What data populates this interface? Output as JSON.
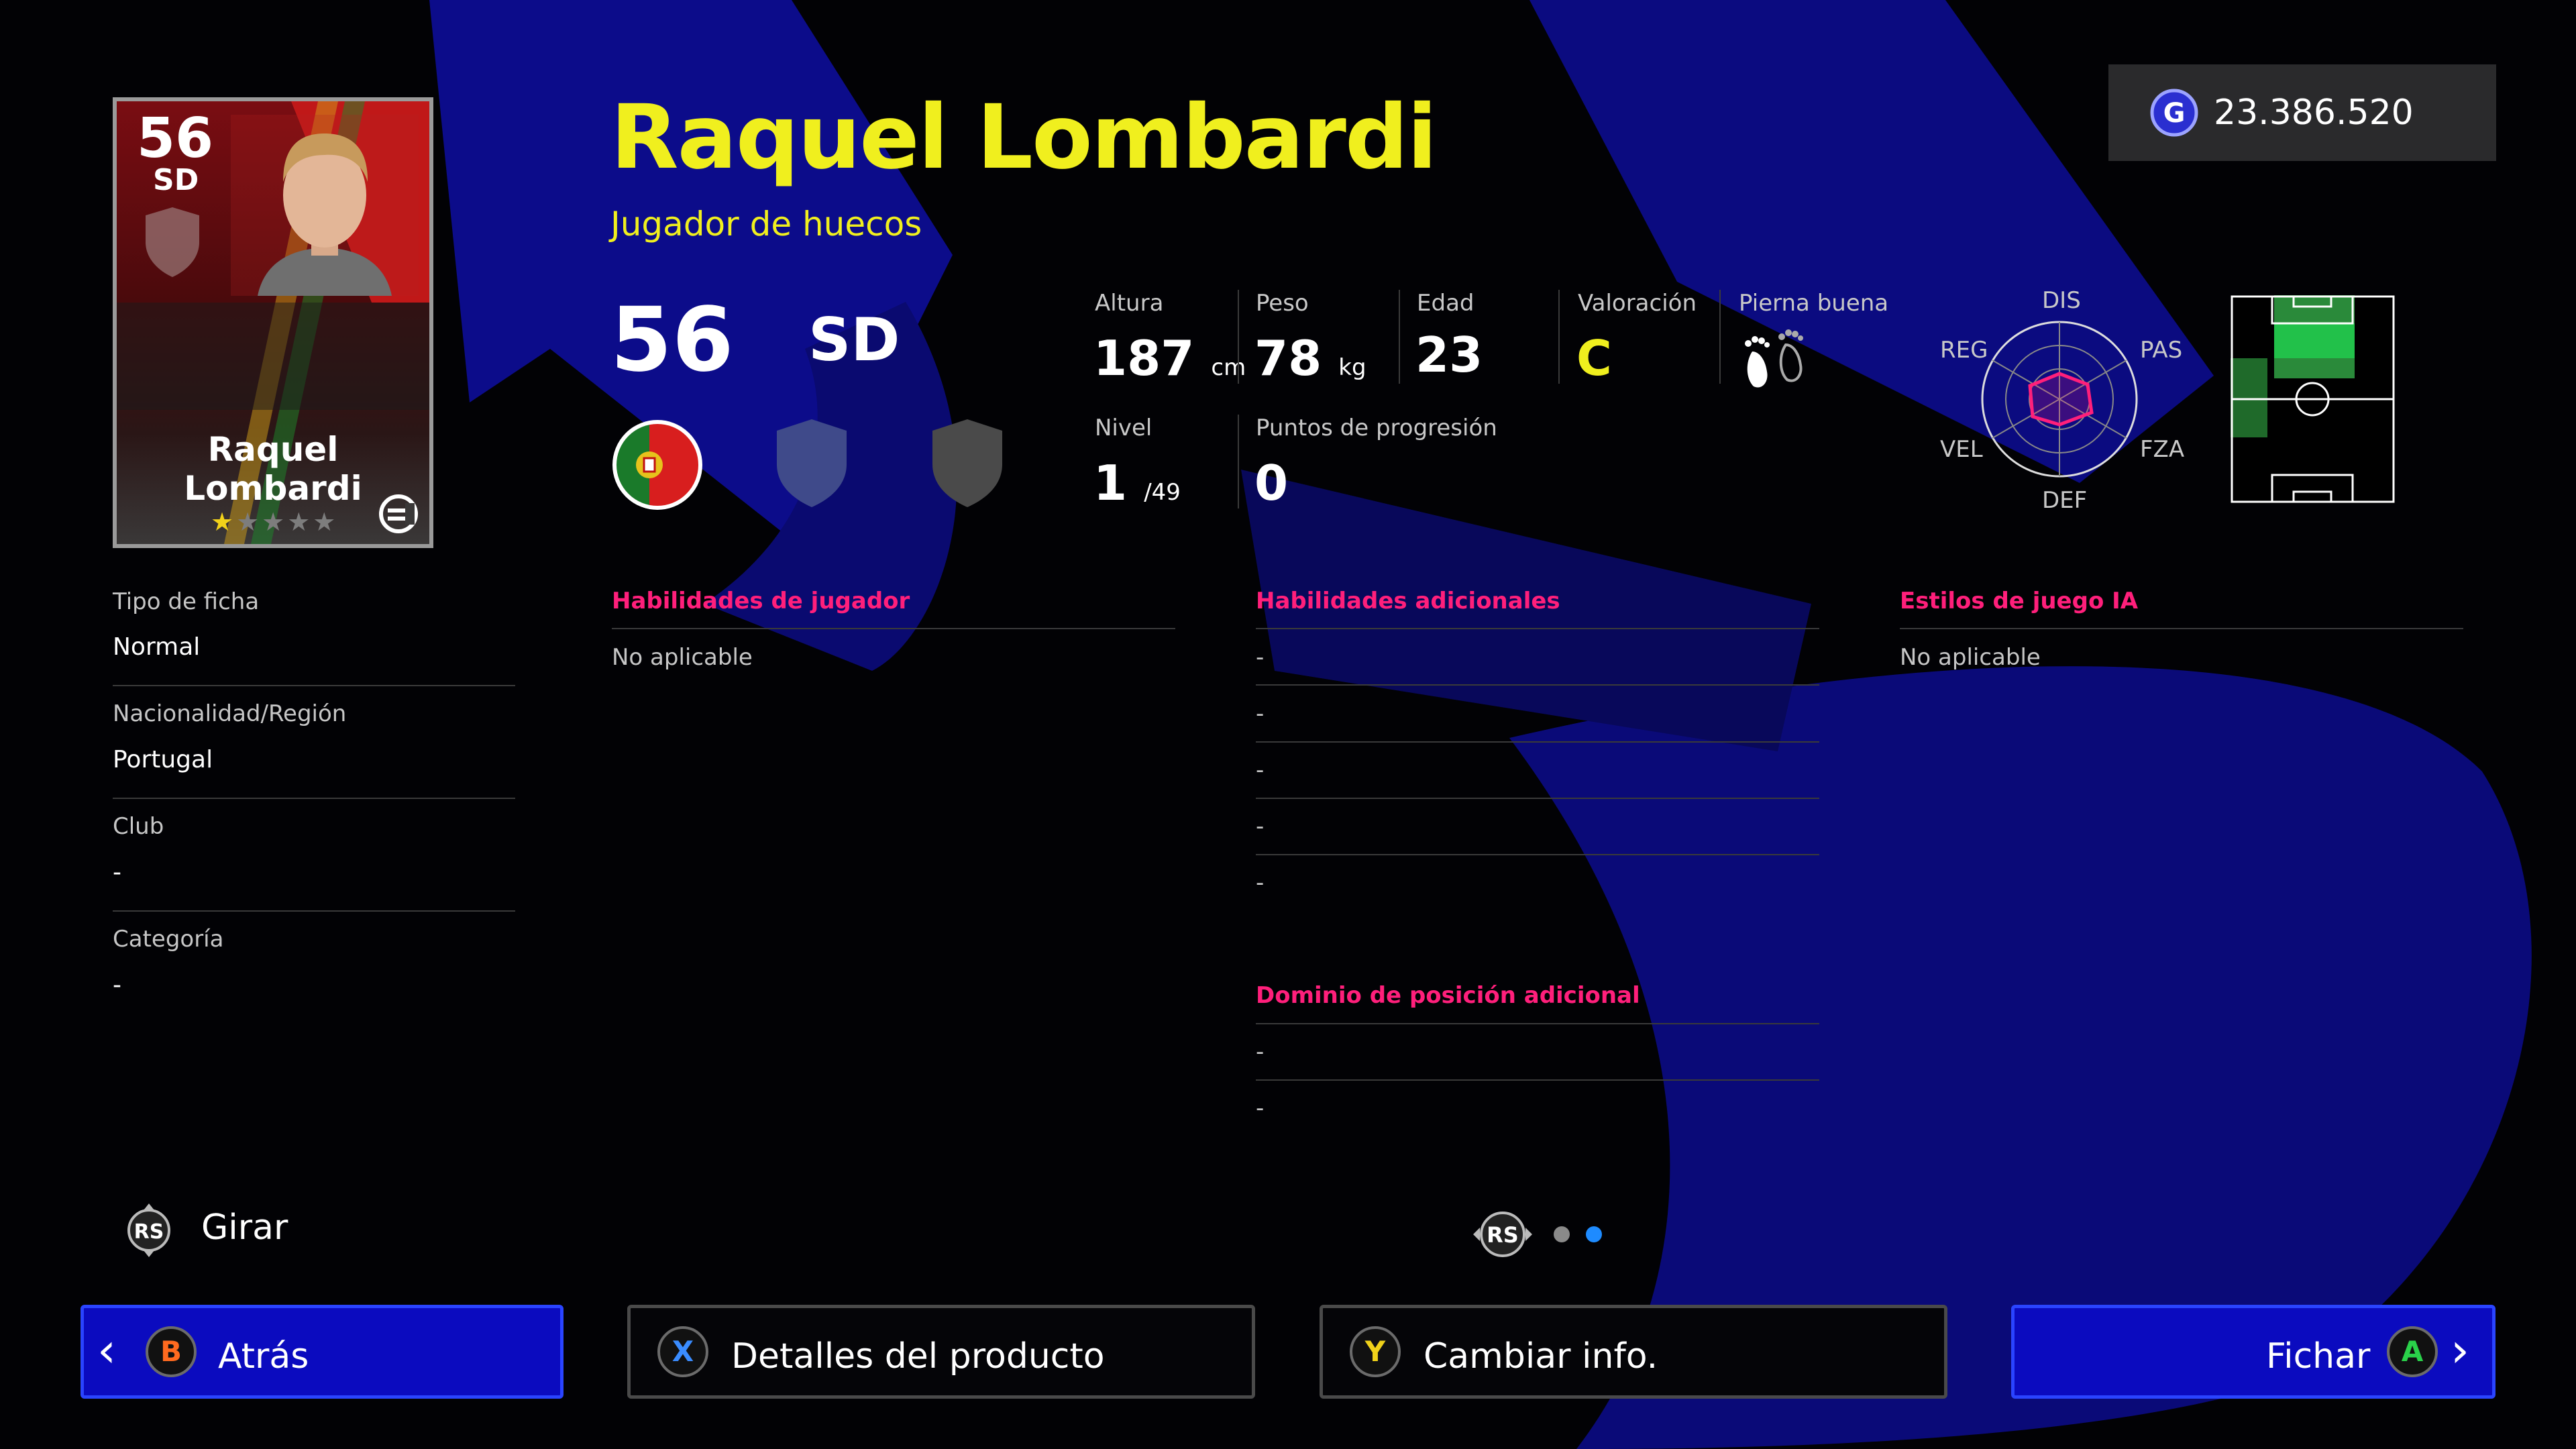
{
  "player": {
    "name": "Raquel Lombardi",
    "role": "Jugador de huecos",
    "rating": "56",
    "position": "SD",
    "card_name": "Raquel Lombardi"
  },
  "coins": {
    "value": "23.386.520",
    "icon": "gp-coin-icon"
  },
  "stats": {
    "altura_label": "Altura",
    "altura_value": "187",
    "altura_unit": "cm",
    "peso_label": "Peso",
    "peso_value": "78",
    "peso_unit": "kg",
    "edad_label": "Edad",
    "edad_value": "23",
    "valoracion_label": "Valoración",
    "valoracion_value": "C",
    "pierna_label": "Pierna buena",
    "nivel_label": "Nivel",
    "nivel_value": "1",
    "nivel_max": "/49",
    "progresion_label": "Puntos de progresión",
    "progresion_value": "0"
  },
  "radar": {
    "top": "DIS",
    "top_right": "PAS",
    "bottom_right": "FZA",
    "bottom": "DEF",
    "bottom_left": "VEL",
    "top_left": "REG"
  },
  "info": [
    {
      "label": "Tipo de ficha",
      "value": "Normal"
    },
    {
      "label": "Nacionalidad/Región",
      "value": "Portugal"
    },
    {
      "label": "Club",
      "value": "-"
    },
    {
      "label": "Categoría",
      "value": "-"
    }
  ],
  "sections": {
    "habilidades_jugador": {
      "title": "Habilidades de jugador",
      "value": "No aplicable"
    },
    "habilidades_adicionales": {
      "title": "Habilidades adicionales",
      "items": [
        "-",
        "-",
        "-",
        "-",
        "-"
      ]
    },
    "estilos_ia": {
      "title": "Estilos de juego IA",
      "value": "No aplicable"
    },
    "dominio_posicion": {
      "title": "Dominio de posición adicional",
      "items": [
        "-",
        "-"
      ]
    }
  },
  "controls": {
    "rs_label": "RS",
    "girar": "Girar",
    "pager_rs": "RS",
    "back": {
      "key": "B",
      "label": "Atrás"
    },
    "details": {
      "key": "X",
      "label": "Detalles del producto"
    },
    "change": {
      "key": "Y",
      "label": "Cambiar info."
    },
    "sign": {
      "key": "A",
      "label": "Fichar"
    }
  },
  "colors": {
    "accent_yellow": "#f0ef1e",
    "accent_pink": "#ff1f7b",
    "button_blue": "#0b0bbf"
  }
}
